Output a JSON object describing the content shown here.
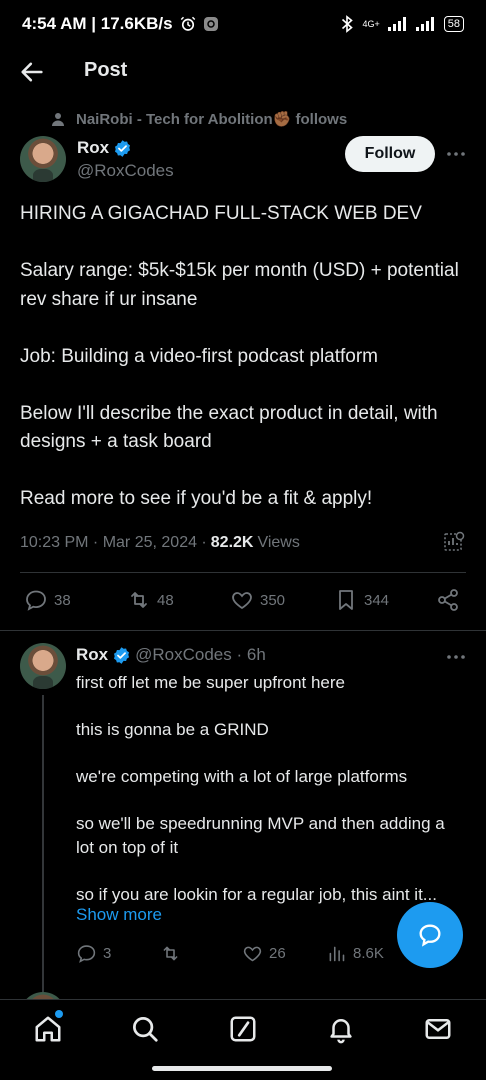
{
  "status_bar": {
    "time_speed": "4:54 AM | 17.6KB/s",
    "network": "4G+",
    "battery": "58"
  },
  "header": {
    "title": "Post"
  },
  "post": {
    "social_context": "NaiRobi - Tech for Abolition✊🏾 follows",
    "author_name": "Rox",
    "author_handle": "@RoxCodes",
    "follow_label": "Follow",
    "paragraphs": [
      "HIRING A GIGACHAD FULL-STACK WEB DEV",
      "Salary range: $5k-$15k per month (USD) + potential rev share if ur insane",
      "Job: Building a video-first podcast platform",
      "Below I'll describe the exact product in detail, with designs + a task board",
      "Read more to see if you'd be a fit & apply!"
    ],
    "timestamp": "10:23 PM · Mar 25, 2024 · ",
    "views_count": "82.2K",
    "views_label": "Views",
    "stats": {
      "replies": "38",
      "reposts": "48",
      "likes": "350",
      "bookmarks": "344"
    }
  },
  "reply": {
    "author_name": "Rox",
    "sub": "@RoxCodes · 6h",
    "paragraphs": [
      "first off let me be super upfront here",
      "this is gonna be a GRIND",
      "we're competing with a lot of large platforms",
      "so we'll be speedrunning MVP and then adding a lot on top of it",
      "so if you are lookin for a regular job, this aint it..."
    ],
    "show_more": "Show more",
    "stats": {
      "replies": "3",
      "likes": "26",
      "views": "8.6K"
    }
  },
  "colors": {
    "accent": "#1d9bf0",
    "background": "#000000",
    "text": "#e7e9ea",
    "muted": "#71767b"
  }
}
